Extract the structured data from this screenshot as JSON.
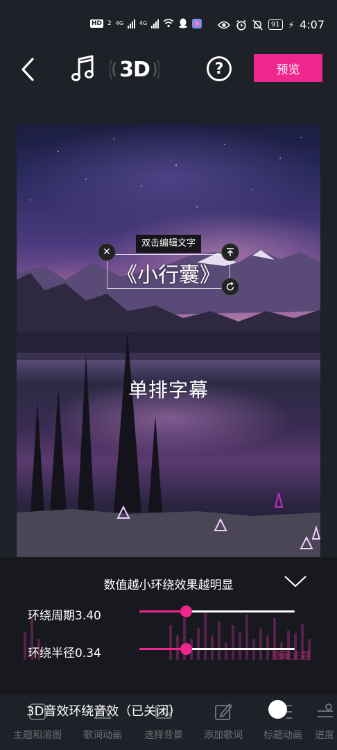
{
  "status_bar": {
    "hd_label": "HD",
    "hd_sub": "2",
    "net1": "4G",
    "net2": "4G",
    "battery": "91",
    "time": "4:07"
  },
  "toolbar": {
    "threed_label": "3D",
    "help_label": "?",
    "preview_label": "预览"
  },
  "canvas": {
    "edit_hint": "双击编辑文字",
    "title_text": "《小行囊》",
    "subtitle_text": "单排字幕"
  },
  "panel": {
    "hint": "数值越小环绕效果越明显",
    "sliders": [
      {
        "label": "环绕周期3.40",
        "value": 0.3
      },
      {
        "label": "环绕半径0.34",
        "value": 0.3
      }
    ],
    "hide_theme_label": "隐藏主题"
  },
  "bottom": {
    "effect_label": "3D音效环绕音效（已关闭）",
    "tabs": [
      {
        "label": "主题和溶图",
        "icon": "theme-icon"
      },
      {
        "label": "歌词动画",
        "icon": "lyrics-animation-icon"
      },
      {
        "label": "选择背景",
        "icon": "background-icon"
      },
      {
        "label": "添加歌词",
        "icon": "edit-icon"
      },
      {
        "label": "标题动画",
        "icon": "title-animation-icon"
      },
      {
        "label": "进度",
        "icon": "progress-icon"
      }
    ]
  },
  "colors": {
    "accent": "#f0268f",
    "background": "#1e2127"
  }
}
